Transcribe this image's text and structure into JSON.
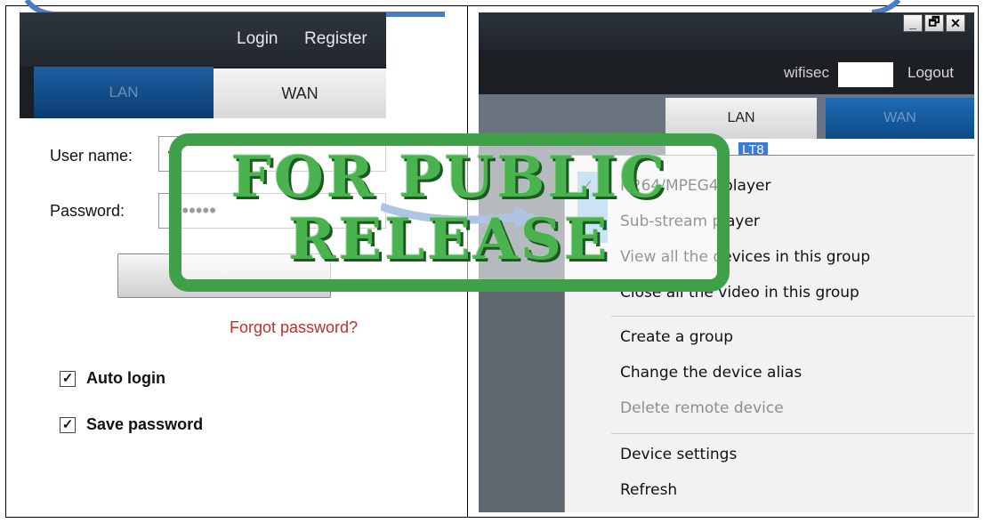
{
  "left": {
    "login": "Login",
    "register": "Register",
    "tab_lan": "LAN",
    "tab_wan": "WAN",
    "username_label": "User name:",
    "username_value": "w",
    "password_label": "Password:",
    "password_value": "•••••••",
    "login_button": "",
    "forgot": "Forgot password?",
    "auto_login": "Auto login",
    "save_password": "Save password",
    "auto_login_checked": true,
    "save_password_checked": true
  },
  "right": {
    "window_buttons": [
      "_",
      "🗗",
      "✕"
    ],
    "username": "wifisec",
    "logout": "Logout",
    "tab_lan": "LAN",
    "tab_wan": "WAN",
    "tree_item": "LT8",
    "menu": {
      "group1": [
        "H264/MPEG4 player",
        "Sub-stream player",
        "View all the devices in this group",
        "Close all the video in this group"
      ],
      "group2": [
        "Create a group",
        "Change the device alias",
        "Delete remote device"
      ],
      "group3": [
        "Device settings",
        "Refresh"
      ],
      "disabled": "Delete remote device"
    }
  },
  "stamp": {
    "line1": "FOR PUBLIC",
    "line2": "RELEASE"
  },
  "colors": {
    "stamp_green": "#3fa04a",
    "link_red": "#c0302a",
    "tab_blue": "#0c4a86"
  }
}
